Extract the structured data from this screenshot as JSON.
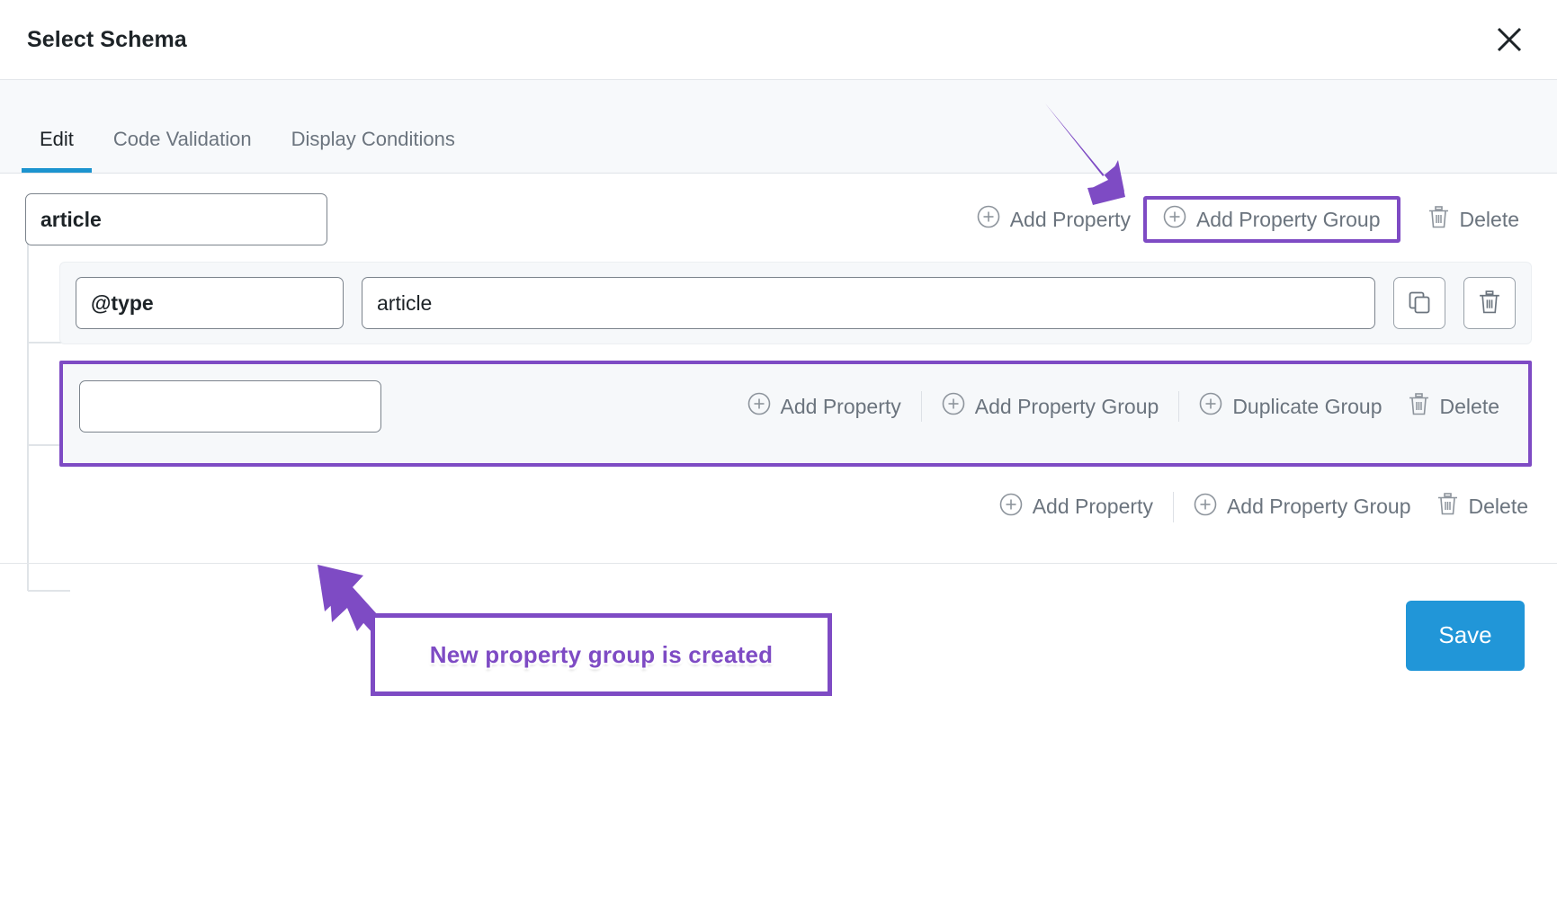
{
  "header": {
    "title": "Select Schema",
    "close_icon": "close-icon"
  },
  "tabs": [
    {
      "label": "Edit",
      "active": true
    },
    {
      "label": "Code Validation",
      "active": false
    },
    {
      "label": "Display Conditions",
      "active": false
    }
  ],
  "editor": {
    "root": {
      "name_value": "article",
      "name_placeholder": "",
      "actions": [
        {
          "label": "Add Property",
          "icon": "plus-circle-icon"
        },
        {
          "label": "Add Property Group",
          "icon": "plus-circle-icon",
          "highlighted": true
        },
        {
          "label": "Delete",
          "icon": "trash-icon"
        }
      ]
    },
    "properties": [
      {
        "key": "@type",
        "value": "article",
        "duplicate_icon": "copy-icon",
        "delete_icon": "trash-icon"
      }
    ],
    "new_group": {
      "name_value": "",
      "name_placeholder": "",
      "highlighted": true,
      "actions": [
        {
          "label": "Add Property",
          "icon": "plus-circle-icon"
        },
        {
          "label": "Add Property Group",
          "icon": "plus-circle-icon"
        },
        {
          "label": "Duplicate Group",
          "icon": "plus-circle-icon"
        },
        {
          "label": "Delete",
          "icon": "trash-icon"
        }
      ]
    },
    "root_bottom_actions": [
      {
        "label": "Add Property",
        "icon": "plus-circle-icon"
      },
      {
        "label": "Add Property Group",
        "icon": "plus-circle-icon"
      },
      {
        "label": "Delete",
        "icon": "trash-icon"
      }
    ]
  },
  "footer": {
    "save_label": "Save"
  },
  "annotations": {
    "callout_text": "New property group is created",
    "accent_color": "#7e4bc4",
    "arrow_to_add_group": "arrow-icon",
    "arrow_to_new_group": "arrow-icon"
  },
  "colors": {
    "accent_purple": "#7e4bc4",
    "save_blue": "#2196d8",
    "tab_underline": "#1c94cf",
    "panel_gray": "#f6f8fa"
  }
}
